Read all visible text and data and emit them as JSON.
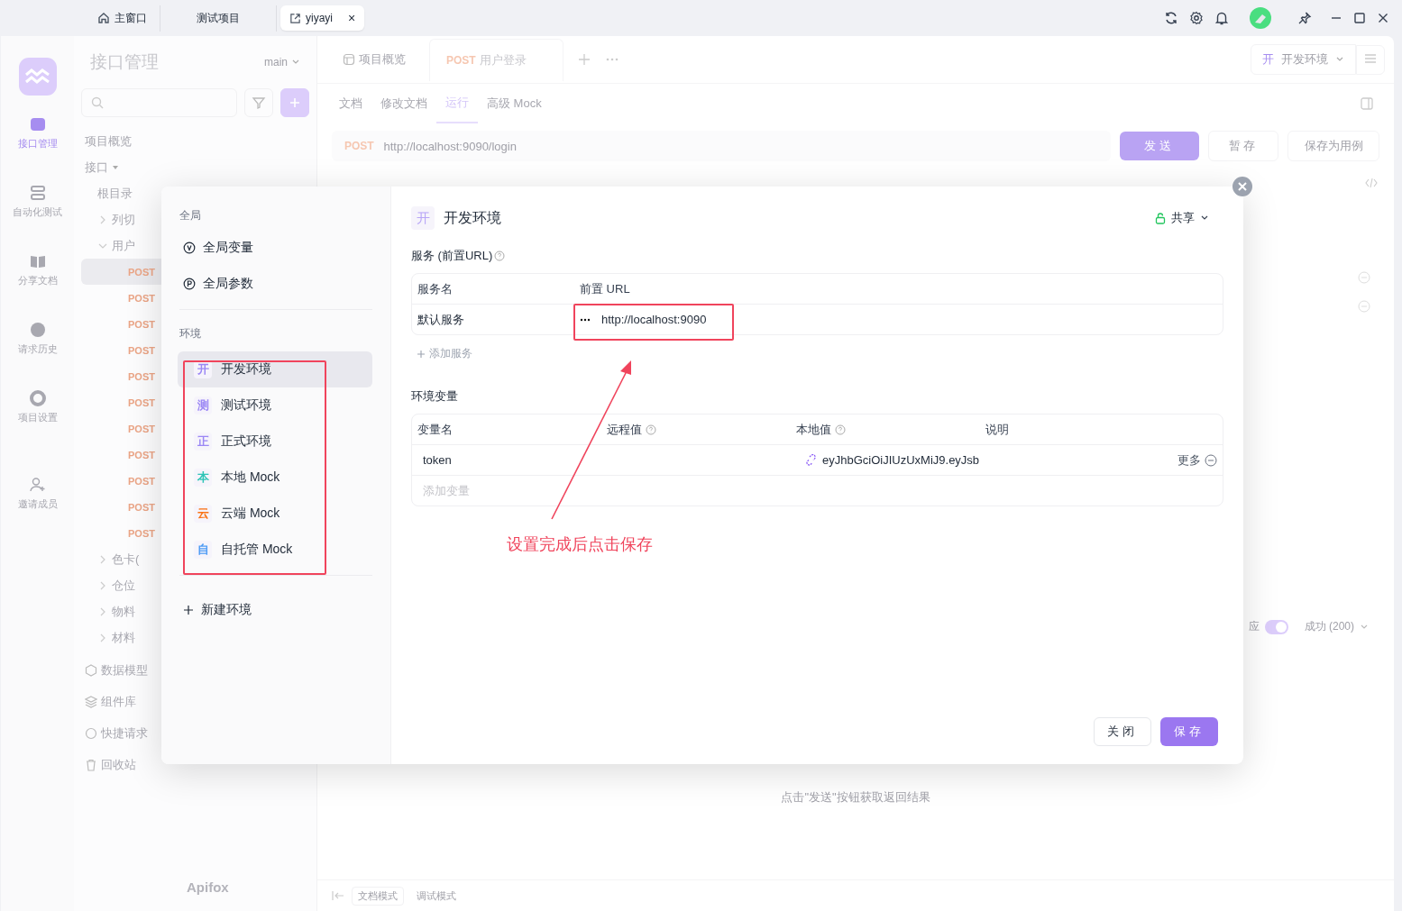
{
  "titlebar": {
    "tabs": [
      {
        "kind": "home",
        "label": "主窗口",
        "selected": false
      },
      {
        "kind": "plain",
        "label": "测试项目",
        "selected": false
      },
      {
        "kind": "project",
        "label": "yiyayi",
        "selected": true,
        "close": "×"
      }
    ]
  },
  "rail": {
    "items": [
      {
        "kind": "api",
        "label": "接口管理",
        "selected": true
      },
      {
        "kind": "auto",
        "label": "自动化测试",
        "selected": false
      },
      {
        "kind": "doc",
        "label": "分享文档",
        "selected": false
      },
      {
        "kind": "history",
        "label": "请求历史",
        "selected": false
      },
      {
        "kind": "settings",
        "label": "项目设置",
        "selected": false
      },
      {
        "kind": "invite",
        "label": "邀请成员",
        "selected": false
      }
    ]
  },
  "tree": {
    "title": "接口管理",
    "branch": "main",
    "overview": "项目概览",
    "api_label": "接口",
    "root": "根目录",
    "folders_top": [
      {
        "label": "列切",
        "expanded": false
      },
      {
        "label": "用户",
        "expanded": true,
        "children": [
          {
            "method": "POST",
            "selected": true
          },
          {
            "method": "POST",
            "selected": false
          },
          {
            "method": "POST",
            "selected": false
          },
          {
            "method": "POST",
            "selected": false
          },
          {
            "method": "POST",
            "selected": false
          },
          {
            "method": "POST",
            "selected": false
          },
          {
            "method": "POST",
            "selected": false
          },
          {
            "method": "POST",
            "selected": false
          },
          {
            "method": "POST",
            "selected": false
          },
          {
            "method": "POST",
            "selected": false
          },
          {
            "method": "POST",
            "selected": false
          }
        ]
      }
    ],
    "folders_bottom": [
      {
        "label": "色卡(",
        "expanded": false
      },
      {
        "label": "仓位",
        "expanded": false
      },
      {
        "label": "物料",
        "expanded": false
      },
      {
        "label": "材料",
        "expanded": false
      }
    ],
    "extras": [
      {
        "kind": "model",
        "label": "数据模型"
      },
      {
        "kind": "lib",
        "label": "组件库"
      },
      {
        "kind": "quick",
        "label": "快捷请求"
      },
      {
        "kind": "trash",
        "label": "回收站"
      }
    ],
    "logo": "Apifox"
  },
  "main": {
    "doc_tabs": [
      {
        "kind": "overview",
        "label": "项目概览",
        "selected": false
      },
      {
        "kind": "request",
        "method": "POST",
        "label": "用户登录",
        "selected": true
      }
    ],
    "env_select": {
      "badge": "开",
      "label": "开发环境"
    },
    "sub_tabs": [
      {
        "label": "文档",
        "selected": false
      },
      {
        "label": "修改文档",
        "selected": false
      },
      {
        "label": "运行",
        "selected": true
      },
      {
        "label": "高级 Mock",
        "selected": false
      }
    ],
    "request": {
      "method": "POST",
      "url": "http://localhost:9090/login",
      "send": "发送",
      "save_draft": "暂存",
      "save_case": "保存为用例"
    },
    "response": {
      "label": "应",
      "toggle_on": true,
      "status": "成功 (200)",
      "hint": "点击\"发送\"按钮获取返回结果"
    },
    "footer": {
      "modes": [
        {
          "label": "文档模式",
          "selected": true
        },
        {
          "label": "调试模式",
          "selected": false
        }
      ]
    }
  },
  "modal": {
    "global_label": "全局",
    "globals": [
      {
        "kind": "variables",
        "label": "全局变量"
      },
      {
        "kind": "params",
        "label": "全局参数"
      }
    ],
    "env_label": "环境",
    "environments": [
      {
        "badge": "开",
        "label": "开发环境",
        "color": "#9b87f5",
        "selected": true
      },
      {
        "badge": "测",
        "label": "测试环境",
        "color": "#9b87f5",
        "selected": false
      },
      {
        "badge": "正",
        "label": "正式环境",
        "color": "#9b87f5",
        "selected": false
      },
      {
        "badge": "本",
        "label": "本地 Mock",
        "color": "#2ec4b6",
        "selected": false
      },
      {
        "badge": "云",
        "label": "云端 Mock",
        "color": "#f97316",
        "selected": false
      },
      {
        "badge": "自",
        "label": "自托管 Mock",
        "color": "#4f9cf5",
        "selected": false
      }
    ],
    "new_env": "新建环境",
    "detail": {
      "badge": "开",
      "title": "开发环境",
      "share": "共享",
      "services_label": "服务 (前置URL)",
      "services": {
        "columns": [
          "服务名",
          "前置 URL"
        ],
        "rows": [
          {
            "name": "默认服务",
            "url": "http://localhost:9090"
          }
        ],
        "add": "添加服务"
      },
      "variables_label": "环境变量",
      "variables": {
        "columns": [
          {
            "label": "变量名",
            "help": false
          },
          {
            "label": "远程值",
            "help": true
          },
          {
            "label": "本地值",
            "help": true
          },
          {
            "label": "说明",
            "help": false
          }
        ],
        "rows": [
          {
            "name": "token",
            "local": "eyJhbGciOiJIUzUxMiJ9.eyJsb",
            "more": "更多"
          }
        ],
        "placeholder": "添加变量"
      }
    },
    "annotation": "设置完成后点击保存",
    "buttons": {
      "close": "关闭",
      "save": "保存"
    }
  }
}
